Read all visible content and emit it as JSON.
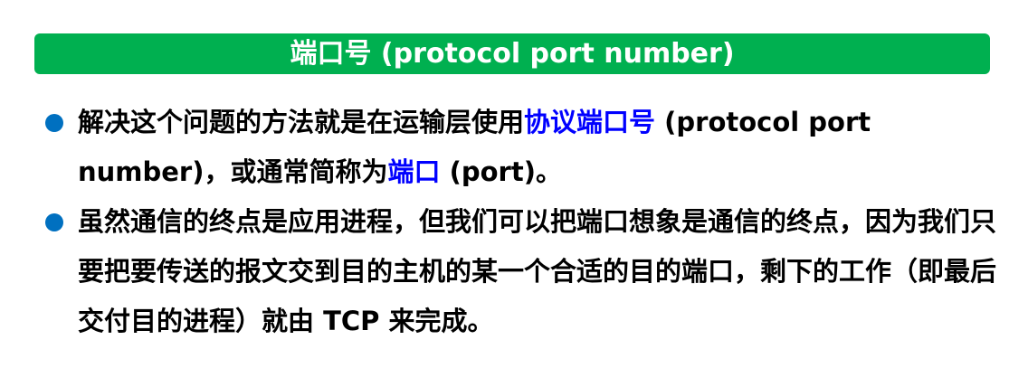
{
  "title": "端口号 (protocol port number)",
  "bullets": [
    {
      "part1": "解决这个问题的方法就是在运输层使用",
      "highlight1": "协议端口号",
      "part2": " (protocol port number)，或通常简称为",
      "highlight2": "端口",
      "part3": " (port)。"
    },
    {
      "text": "虽然通信的终点是应用进程，但我们可以把端口想象是通信的终点，因为我们只要把要传送的报文交到目的主机的某一个合适的目的端口，剩下的工作（即最后交付目的进程）就由 TCP 来完成。"
    }
  ],
  "colors": {
    "title_bg": "#00b050",
    "title_text": "#ffffff",
    "bullet_dot": "#0070c0",
    "highlight": "#0000ff"
  }
}
